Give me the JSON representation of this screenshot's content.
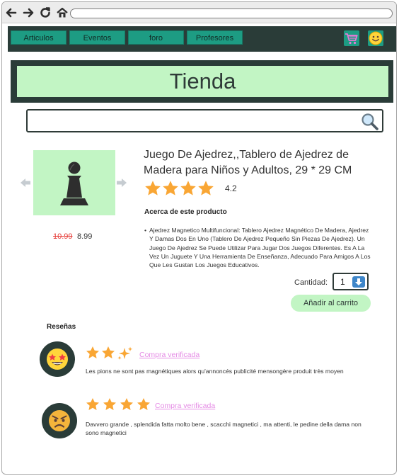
{
  "browser": {
    "back_icon": "arrow-left-icon",
    "forward_icon": "arrow-right-icon",
    "reload_icon": "reload-icon",
    "home_icon": "home-icon",
    "url": ""
  },
  "nav": {
    "tabs": [
      {
        "label": "Articulos"
      },
      {
        "label": "Eventos"
      },
      {
        "label": "foro"
      },
      {
        "label": "Profesores"
      }
    ],
    "cart_icon": "cart-icon",
    "profile_icon": "smiley-icon"
  },
  "banner": {
    "title": "Tienda"
  },
  "search": {
    "placeholder": "",
    "value": "",
    "icon": "magnifier-icon"
  },
  "product": {
    "title": "Juego De Ajedrez,,Tablero de Ajedrez de Madera para Niños y Adultos, 29 * 29 CM",
    "image_icon": "chess-pawn-icon",
    "price_old": "10.99",
    "price_new": "8.99",
    "rating": "4.2",
    "stars": 4,
    "about_heading": "Acerca de este producto",
    "bullet": "•",
    "description": "Ajedrez Magnetico Multifuncional: Tablero Ajedrez Magnético De Madera, Ajedrez Y Damas Dos En Uno (Tablero De Ajedrez Pequeño Sin Piezas De Ajedrez). Un Juego De Ajedrez Se Puede Utilizar Para Jugar Dos Juegos Diferentes. Es A La Vez Un Juguete Y Una Herramienta De Enseñanza, Adecuado Para Amigos A Los Que Les Gustan Los Juegos Educativos.",
    "quantity_label": "Cantidad:",
    "quantity_value": "1",
    "add_to_cart": "Añadir al carrito"
  },
  "reviews": {
    "heading": "Reseñas",
    "items": [
      {
        "avatar_icon": "star-struck-face-icon",
        "stars": 2.5,
        "verified": "Compra verificada",
        "text": "Les pions ne sont pas magnétiques alors qu'annoncés publicité mensongère produit très moyen"
      },
      {
        "avatar_icon": "angry-face-icon",
        "stars": 4,
        "verified": "Compra verificada",
        "text": "Davvero grande , splendida fatta molto bene , scacchi magnetici , ma attenti, le pedine della dama non sono magnetici"
      }
    ]
  },
  "colors": {
    "dark_green": "#2a3c38",
    "teal": "#1d9c83",
    "mint": "#c2f5c4",
    "star": "#f9a634",
    "old_price": "#e53935",
    "verified_link": "#e58be5",
    "dropdown_blue": "#3e86c9"
  }
}
